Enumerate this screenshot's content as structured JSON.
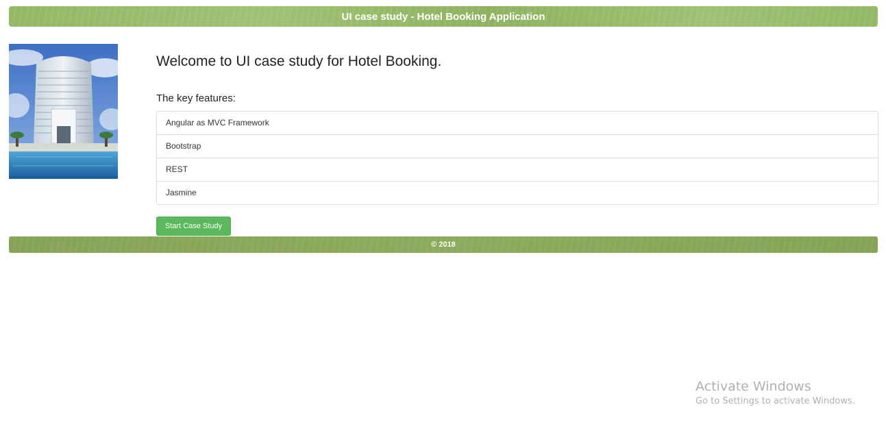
{
  "header": {
    "title": "UI case study - Hotel Booking Application"
  },
  "main": {
    "welcome": "Welcome to UI case study for Hotel Booking.",
    "features_heading": "The key features:",
    "features": [
      "Angular as MVC Framework",
      "Bootstrap",
      "REST",
      "Jasmine"
    ],
    "start_button": "Start Case Study",
    "image": "hotel-building-photo"
  },
  "footer": {
    "text": "© 2018"
  },
  "watermark": {
    "title": "Activate Windows",
    "subtitle": "Go to Settings to activate Windows."
  },
  "colors": {
    "header_green": "#9fc273",
    "footer_green": "#8cab5c",
    "button_green": "#5cb85c"
  }
}
